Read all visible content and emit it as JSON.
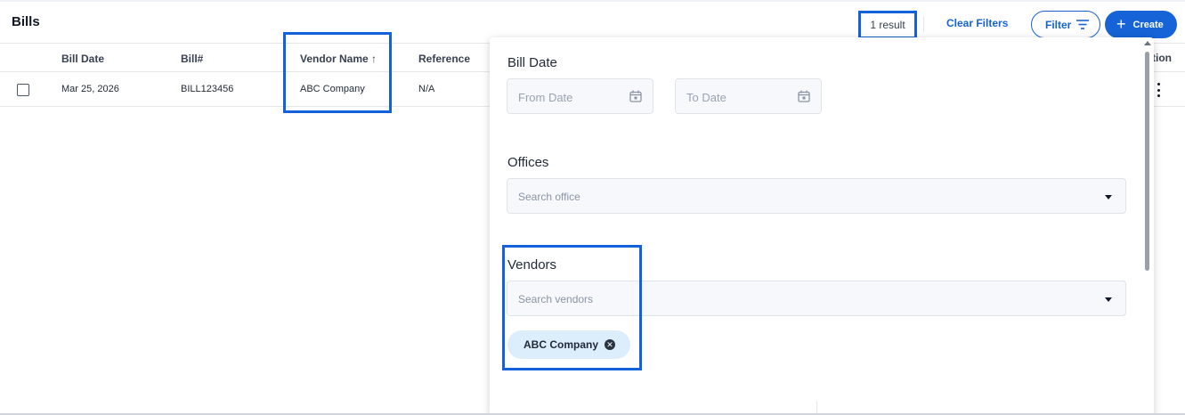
{
  "header": {
    "title": "Bills",
    "result_count": "1 result",
    "clear_filters_label": "Clear Filters",
    "filter_label": "Filter",
    "create_label": "Create"
  },
  "table": {
    "columns": [
      "Bill Date",
      "Bill#",
      "Vendor Name ↑",
      "Reference",
      "tion"
    ],
    "rows": [
      {
        "bill_date": "Mar 25, 2026",
        "bill_number": "BILL123456",
        "vendor_name": "ABC Company",
        "reference": "N/A"
      }
    ]
  },
  "filter_panel": {
    "bill_date_label": "Bill Date",
    "from_date_placeholder": "From Date",
    "to_date_placeholder": "To Date",
    "offices_label": "Offices",
    "offices_placeholder": "Search office",
    "vendors_label": "Vendors",
    "vendors_placeholder": "Search vendors",
    "selected_vendor_chip": "ABC Company"
  },
  "colors": {
    "accent": "#1563d6",
    "highlight_box": "#1362d9",
    "chip_bg": "#dceefc"
  },
  "icons": [
    "calendar-icon",
    "chevron-down-icon",
    "close-icon",
    "filter-lines-icon",
    "plus-icon",
    "more-vertical-icon"
  ]
}
